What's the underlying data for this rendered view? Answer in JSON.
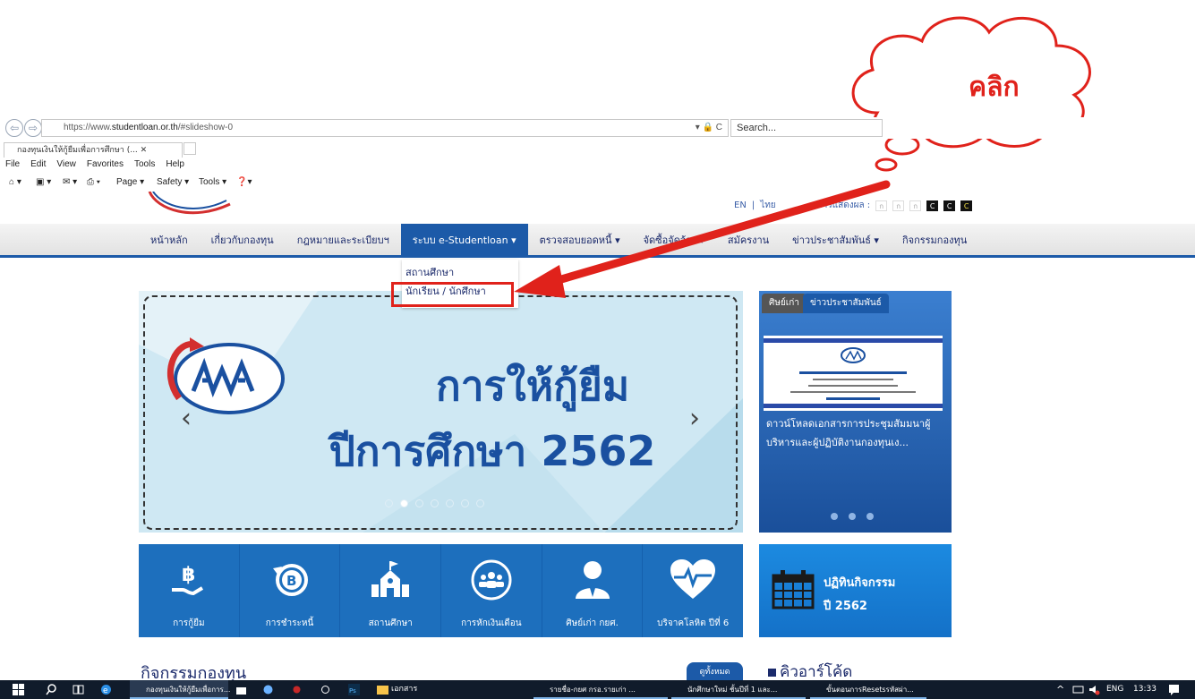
{
  "callout": {
    "text": "คลิก"
  },
  "browser": {
    "url_prefix": "https://www.",
    "url_domain": "studentloan.or.th",
    "url_path": "/#slideshow-0",
    "url_controls": "▾ 🔒 C",
    "search_placeholder": "Search...",
    "tab_title": "กองทุนเงินให้กู้ยืมเพื่อการศึกษา (... ✕",
    "menu": [
      "File",
      "Edit",
      "View",
      "Favorites",
      "Tools",
      "Help"
    ],
    "commands": {
      "page": "Page ▾",
      "safety": "Safety ▾",
      "tools": "Tools ▾"
    }
  },
  "site": {
    "lang_en": "EN",
    "lang_sep": "|",
    "lang_th": "ไทย",
    "display_label": "การแสดงผล :",
    "font_sizes": [
      "ก",
      "ก",
      "ก",
      "C",
      "C",
      "C"
    ],
    "nav": [
      "หน้าหลัก",
      "เกี่ยวกับกองทุน",
      "กฎหมายและระเบียบฯ",
      "ระบบ e-Studentloan ▾",
      "ตรวจสอบยอดหนี้ ▾",
      "จัดซื้อจัดจ้าง ▾",
      "สมัครงาน",
      "ข่าวประชาสัมพันธ์ ▾",
      "กิจกรรมกองทุน"
    ],
    "dropdown": [
      "สถานศึกษา",
      "นักเรียน / นักศึกษา"
    ]
  },
  "slideshow": {
    "logo_text": "กยศ",
    "title_line1": "การให้กู้ยืม",
    "title_line2": "ปีการศึกษา 2562",
    "prev": "‹",
    "next": "›",
    "dot_count": 7,
    "active_dot": 1
  },
  "news": {
    "tab_alumni": "ศิษย์เก่า",
    "tab_pr": "ข่าวประชาสัมพันธ์",
    "image_text": "ประชุมสัมมนาผู้บริหารและผู้ปฏิบัติงานกองทุนเงินให้กู้ยืมเพื่อการศึกษา",
    "caption": "ดาวน์โหลดเอกสารการประชุมสัมมนาผู้บริหารและผู้ปฏิบัติงานกองทุนเง..."
  },
  "tiles": [
    {
      "label": "การกู้ยืม",
      "icon": "baht-hand-icon"
    },
    {
      "label": "การชำระหนี้",
      "icon": "baht-refresh-icon"
    },
    {
      "label": "สถานศึกษา",
      "icon": "school-icon"
    },
    {
      "label": "การหักเงินเดือน",
      "icon": "people-circle-icon"
    },
    {
      "label": "ศิษย์เก่า กยศ.",
      "icon": "person-tie-icon"
    },
    {
      "label": "บริจาคโลหิต ปีที่ 6",
      "icon": "heart-pulse-icon"
    }
  ],
  "activity_calendar": {
    "line1": "ปฏิทินกิจกรรม",
    "line2": "ปี 2562"
  },
  "sections": {
    "activities": "กิจกรรมกองทุน",
    "see_all": "ดูทั้งหมด",
    "qr": "คิวอาร์โค้ด"
  },
  "taskbar": {
    "windows": [
      "กองทุนเงินให้กู้ยืมเพื่อการ...",
      "เอกสาร",
      "รายชื่อ-กยศ กรอ.รายเก่า ...",
      "นักศึกษาใหม่ ชั้นปีที่ 1 และ...",
      "ขั้นตอนการResetsรหัสผ่า..."
    ],
    "lang": "ENG",
    "time": "13:33",
    "tray": "^"
  },
  "colors": {
    "nav_blue": "#1c5aa8",
    "highlight_red": "#e0221b",
    "tile_blue": "#1d6fbd"
  }
}
